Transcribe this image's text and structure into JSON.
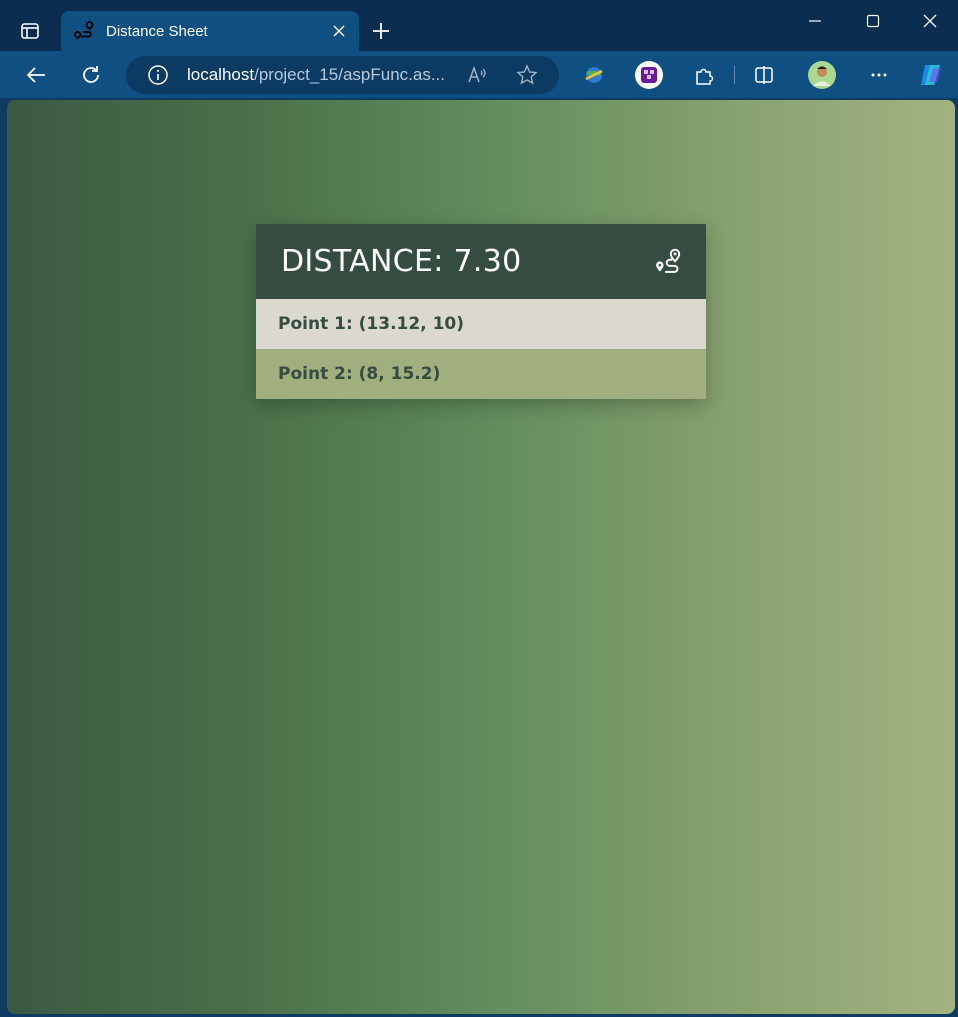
{
  "browser": {
    "tab": {
      "title": "Distance Sheet"
    },
    "address": {
      "host": "localhost",
      "path": "/project_15/aspFunc.as..."
    }
  },
  "page": {
    "distance_label": "DISTANCE: 7.30",
    "points": [
      {
        "label": "Point 1: (13.12, 10)"
      },
      {
        "label": "Point 2: (8, 15.2)"
      }
    ]
  },
  "colors": {
    "header_bg": "#354c40",
    "row1_bg": "#dbd8cf",
    "row2_bg": "#a1ae7e",
    "gradient_left": "#3c5942",
    "gradient_right": "#a2b381"
  },
  "icons": {
    "tab_favicon": "route-icon",
    "card_icon": "route-icon"
  }
}
